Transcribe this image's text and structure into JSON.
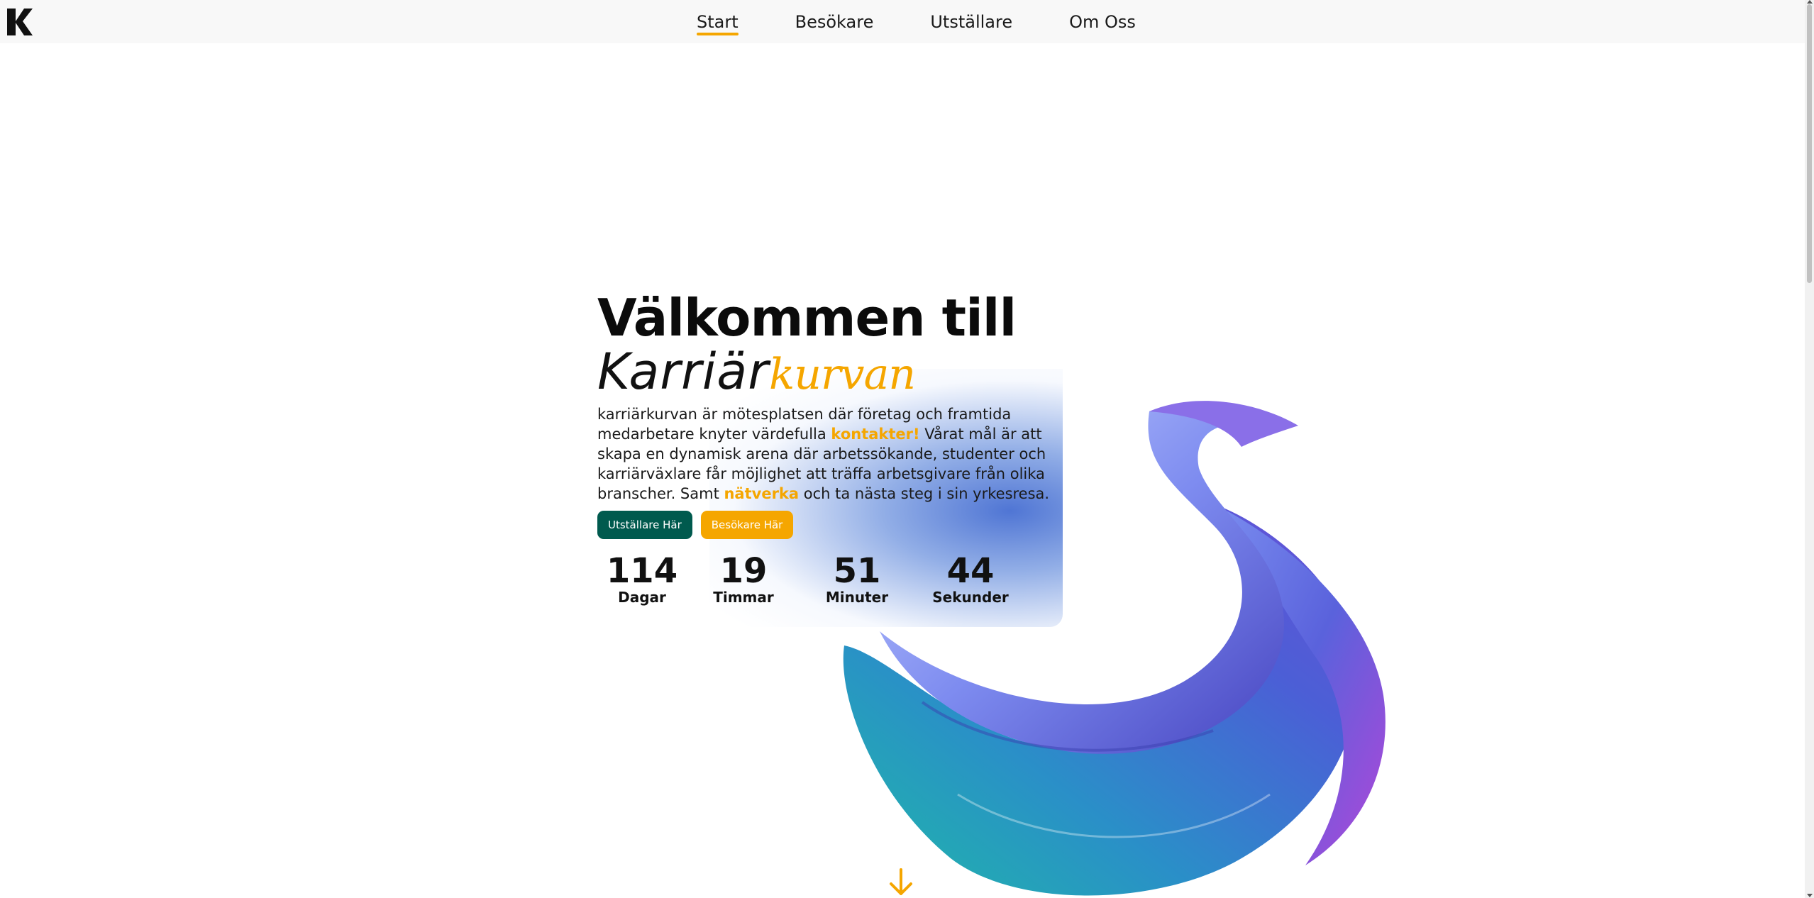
{
  "nav": {
    "items": [
      {
        "label": "Start",
        "active": true
      },
      {
        "label": "Besökare",
        "active": false
      },
      {
        "label": "Utställare",
        "active": false
      },
      {
        "label": "Om Oss",
        "active": false
      }
    ]
  },
  "hero": {
    "title_line1": "Välkommen till",
    "title_part_a": "Karriär",
    "title_part_b": "kurvan",
    "desc_1": "karriärkurvan är mötesplatsen där företag och framtida medarbetare knyter värdefulla ",
    "desc_hl1": "kontakter!",
    "desc_2": " Vårat mål är att skapa en dynamisk arena där arbetssökande, studenter och karriärväxlare får möjlighet att träffa arbetsgivare från olika branscher. Samt ",
    "desc_hl2": "nätverka",
    "desc_3": " och ta nästa steg i sin yrkesresa.",
    "btn_exhibitor": "Utställare Här",
    "btn_visitor": "Besökare Här"
  },
  "countdown": [
    {
      "value": "114",
      "label": "Dagar"
    },
    {
      "value": "19",
      "label": "Timmar"
    },
    {
      "value": "51",
      "label": "Minuter"
    },
    {
      "value": "44",
      "label": "Sekunder"
    }
  ],
  "colors": {
    "accent": "#f5a600",
    "green": "#005a4e"
  },
  "icons": {
    "logo": "k-logo",
    "scroll_down": "arrow-down-icon"
  }
}
